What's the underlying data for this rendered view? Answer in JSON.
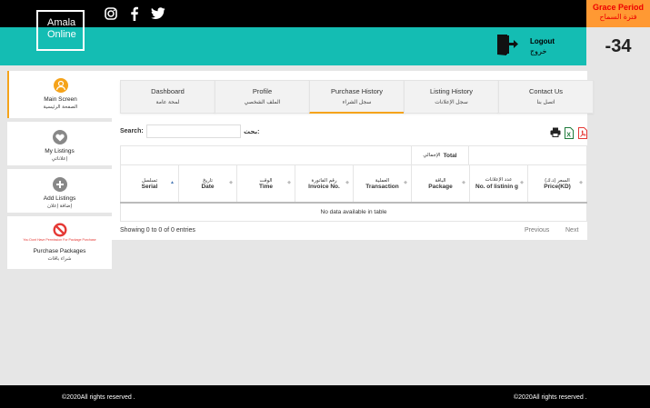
{
  "header": {
    "logo_line1": "Amala",
    "logo_line2": "Online",
    "logout_en": "Logout",
    "logout_ar": "خروج",
    "grace_en": "Grace Period",
    "grace_ar": "فترة السماح",
    "counter": "-34",
    "social_icons": [
      "instagram-icon",
      "facebook-icon",
      "twitter-icon"
    ]
  },
  "sidebar": {
    "items": [
      {
        "label": "Main Screen",
        "sub": "الصفحة الرئيسية",
        "icon": "user-icon"
      },
      {
        "label": "My Listings",
        "sub": "إعلاناتي",
        "icon": "heart-icon"
      },
      {
        "label": "Add Listings",
        "sub": "إضافة إعلان",
        "icon": "plus-icon"
      },
      {
        "label": "Purchase Packages",
        "sub": "شراء باقات",
        "icon": "no-entry-icon",
        "warning": "You Dont Have Permission For Package Purchase"
      }
    ]
  },
  "tabs": [
    {
      "en": "Dashboard",
      "ar": "لمحة عامة"
    },
    {
      "en": "Profile",
      "ar": "الملف الشخصي"
    },
    {
      "en": "Purchase History",
      "ar": "سجل الشراء"
    },
    {
      "en": "Listing History",
      "ar": "سجل الإعلانات"
    },
    {
      "en": "Contact Us",
      "ar": "اتصل بنا"
    }
  ],
  "search": {
    "label_en": "Search:",
    "label_ar": "بحث:",
    "value": ""
  },
  "table": {
    "group_header_en": "Total",
    "group_header_ar": "الإجمالي",
    "columns": [
      {
        "ar": "تسلسل",
        "en": "Serial"
      },
      {
        "ar": "تاريخ",
        "en": "Date"
      },
      {
        "ar": "الوقت",
        "en": "Time"
      },
      {
        "ar": "رقم الفاتورة",
        "en": "Invoice No."
      },
      {
        "ar": "العملية",
        "en": "Transaction"
      },
      {
        "ar": "الباقة",
        "en": "Package"
      },
      {
        "ar": "عدد الإعلانات",
        "en": "No. of listinin g"
      },
      {
        "ar": "السعر (د.ك)",
        "en": "Price(KD)"
      }
    ],
    "empty_text": "No data available in table"
  },
  "pagination": {
    "info": "Showing 0 to 0 of 0 entries",
    "previous": "Previous",
    "next": "Next"
  },
  "footer": {
    "left": "©2020All rights reserved .",
    "right": "©2020All rights reserved ."
  },
  "colors": {
    "teal": "#14bdb3",
    "orange": "#ff9933",
    "tab_active_underline": "#f5a31a",
    "excel_green": "#1d7a3a",
    "pdf_red": "#e53935"
  }
}
